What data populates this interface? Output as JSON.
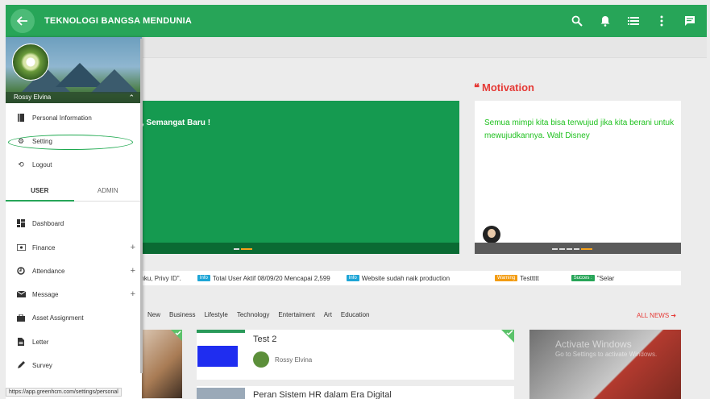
{
  "app": {
    "title": "TEKNOLOGI BANGSA MENDUNIA"
  },
  "colors": {
    "primary": "#27a558",
    "accent": "#e53935",
    "quote": "#1fc11f"
  },
  "topbar": {
    "icons": [
      "search-icon",
      "bell-icon",
      "list-icon",
      "more-vert-icon",
      "chat-icon"
    ]
  },
  "sidebar": {
    "user_name": "Rossy Elvina",
    "profile_menu": [
      {
        "label": "Personal Information",
        "icon": "book-icon"
      },
      {
        "label": "Setting",
        "icon": "gear-icon"
      },
      {
        "label": "Logout",
        "icon": "history-icon"
      }
    ],
    "tabs": [
      {
        "label": "USER"
      },
      {
        "label": "ADMIN"
      }
    ],
    "items": [
      {
        "label": "Dashboard",
        "icon": "dashboard-icon"
      },
      {
        "label": "Finance",
        "icon": "money-icon",
        "expand": "+"
      },
      {
        "label": "Attendance",
        "icon": "clock-icon",
        "expand": "+"
      },
      {
        "label": "Message",
        "icon": "mail-icon",
        "expand": "+"
      },
      {
        "label": "Asset Assignment",
        "icon": "briefcase-icon"
      },
      {
        "label": "Letter",
        "icon": "document-icon"
      },
      {
        "label": "Survey",
        "icon": "pencil-icon"
      }
    ]
  },
  "main": {
    "greeting": ", Semangat Baru !",
    "motivation": {
      "title": "Motivation",
      "quote": "Semua mimpi kita bisa terwujud jika kita berani untuk mewujudkannya. Walt Disney"
    },
    "ticker": [
      {
        "badge": "",
        "text": "anku, Privy ID\".",
        "color": ""
      },
      {
        "badge": "Info",
        "text": "Total User Aktif 08/09/20 Mencapai 2,599",
        "color": "#1ea5d6"
      },
      {
        "badge": "Info",
        "text": "Website sudah naik production",
        "color": "#1ea5d6"
      },
      {
        "badge": "Warning",
        "text": "Testtttt",
        "color": "#f39c12"
      },
      {
        "badge": "Succes :",
        "text": "\"Selar",
        "color": "#27a558"
      }
    ],
    "categories": [
      "New",
      "Business",
      "Lifestyle",
      "Technology",
      "Entertaiment",
      "Art",
      "Education"
    ],
    "all_news": "ALL NEWS",
    "news": [
      {
        "title": "Test 2",
        "author": "Rossy Elvina"
      },
      {
        "title": "Peran Sistem HR dalam Era Digital"
      }
    ],
    "watermark": {
      "line1": "Activate Windows",
      "line2": "Go to Settings to activate Windows."
    }
  },
  "status_url": "https://app.greenhcm.com/settings/personal"
}
